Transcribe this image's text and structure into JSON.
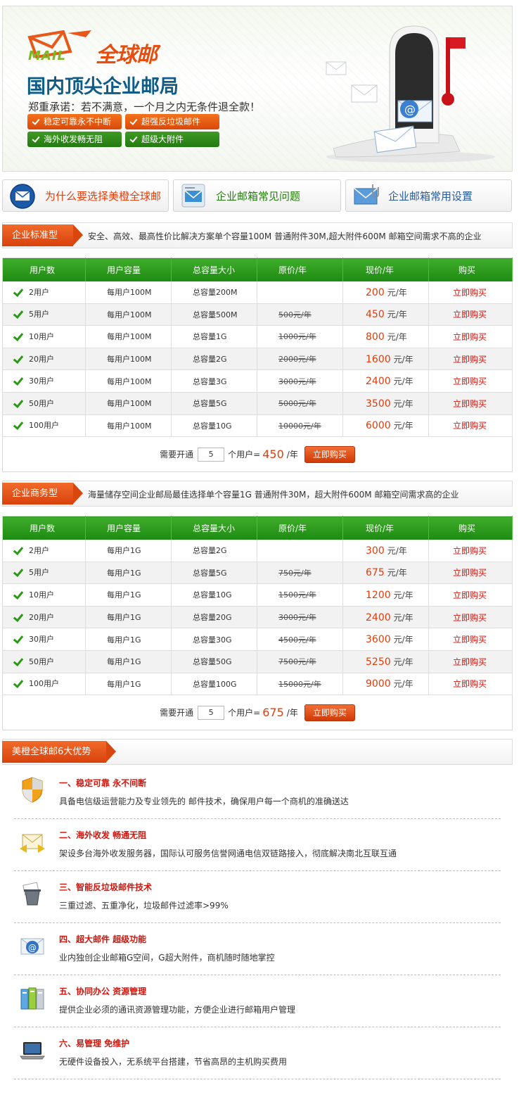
{
  "banner": {
    "logo_mail": "MAIL",
    "logo_text": "全球邮",
    "headline": "国内顶尖企业邮局",
    "promise": "郑重承诺：若不满意，一个月之内无条件退全款！",
    "tags": [
      "稳定可靠永不中断",
      "超强反垃圾邮件",
      "海外收发畅无阻",
      "超级大附件"
    ]
  },
  "quick_links": [
    {
      "label": "为什么要选择美橙全球邮",
      "icon": "email-globe-icon",
      "color": "#e2410f"
    },
    {
      "label": "企业邮箱常见问题",
      "icon": "envelope-card-icon",
      "color": "#277d12"
    },
    {
      "label": "企业邮箱常用设置",
      "icon": "envelope-clip-icon",
      "color": "#2a5c9c"
    }
  ],
  "standard": {
    "tag": "企业标准型",
    "desc": "安全、高效、最高性价比解决方案单个容量100M 普通附件30M,超大附件600M 邮箱空间需求不高的企业",
    "headers": [
      "用户数",
      "用户容量",
      "总容量大小",
      "原价/年",
      "现价/年",
      "购买"
    ],
    "rows": [
      {
        "users": "2用户",
        "per": "每用户100M",
        "total": "总容量200M",
        "orig": "",
        "price": "200",
        "unit": "元/年",
        "buy": "立即购买"
      },
      {
        "users": "5用户",
        "per": "每用户100M",
        "total": "总容量500M",
        "orig": "500元/年",
        "price": "450",
        "unit": "元/年",
        "buy": "立即购买"
      },
      {
        "users": "10用户",
        "per": "每用户100M",
        "total": "总容量1G",
        "orig": "1000元/年",
        "price": "800",
        "unit": "元/年",
        "buy": "立即购买"
      },
      {
        "users": "20用户",
        "per": "每用户100M",
        "total": "总容量2G",
        "orig": "2000元/年",
        "price": "1600",
        "unit": "元/年",
        "buy": "立即购买"
      },
      {
        "users": "30用户",
        "per": "每用户100M",
        "total": "总容量3G",
        "orig": "3000元/年",
        "price": "2400",
        "unit": "元/年",
        "buy": "立即购买"
      },
      {
        "users": "50用户",
        "per": "每用户100M",
        "total": "总容量5G",
        "orig": "5000元/年",
        "price": "3500",
        "unit": "元/年",
        "buy": "立即购买"
      },
      {
        "users": "100用户",
        "per": "每用户100M",
        "total": "总容量10G",
        "orig": "10000元/年",
        "price": "6000",
        "unit": "元/年",
        "buy": "立即购买"
      }
    ],
    "order": {
      "need": "需要开通",
      "qty": "5",
      "per": "个用户=",
      "total": "450",
      "yr": "/年",
      "button": "立即购买"
    }
  },
  "business": {
    "tag": "企业商务型",
    "desc": "海量储存空间企业邮局最佳选择单个容量1G 普通附件30M，超大附件600M 邮箱空间需求高的企业",
    "headers": [
      "用户数",
      "用户容量",
      "总容量大小",
      "原价/年",
      "现价/年",
      "购买"
    ],
    "rows": [
      {
        "users": "2用户",
        "per": "每用户1G",
        "total": "总容量2G",
        "orig": "",
        "price": "300",
        "unit": "元/年",
        "buy": "立即购买"
      },
      {
        "users": "5用户",
        "per": "每用户1G",
        "total": "总容量5G",
        "orig": "750元/年",
        "price": "675",
        "unit": "元/年",
        "buy": "立即购买"
      },
      {
        "users": "10用户",
        "per": "每用户1G",
        "total": "总容量10G",
        "orig": "1500元/年",
        "price": "1200",
        "unit": "元/年",
        "buy": "立即购买"
      },
      {
        "users": "20用户",
        "per": "每用户1G",
        "total": "总容量20G",
        "orig": "3000元/年",
        "price": "2400",
        "unit": "元/年",
        "buy": "立即购买"
      },
      {
        "users": "30用户",
        "per": "每用户1G",
        "total": "总容量30G",
        "orig": "4500元/年",
        "price": "3600",
        "unit": "元/年",
        "buy": "立即购买"
      },
      {
        "users": "50用户",
        "per": "每用户1G",
        "total": "总容量50G",
        "orig": "7500元/年",
        "price": "5250",
        "unit": "元/年",
        "buy": "立即购买"
      },
      {
        "users": "100用户",
        "per": "每用户1G",
        "total": "总容量100G",
        "orig": "15000元/年",
        "price": "9000",
        "unit": "元/年",
        "buy": "立即购买"
      }
    ],
    "order": {
      "need": "需要开通",
      "qty": "5",
      "per": "个用户=",
      "total": "675",
      "yr": "/年",
      "button": "立即购买"
    }
  },
  "advantages": {
    "tag": "美橙全球邮6大优势",
    "items": [
      {
        "title": "一、稳定可靠  永不间断",
        "desc": "具备电信级运营能力及专业领先的 邮件技术，确保用户每一个商机的准确送达",
        "icon": "shield-icon"
      },
      {
        "title": "二、海外收发  畅通无阻",
        "desc": "架设多台海外收发服务器，国际认可服务信誉网通电信双链路接入，彻底解决南北互联互通",
        "icon": "envelope-arrows-icon"
      },
      {
        "title": "三、智能反垃圾邮件技术",
        "desc": "三重过滤、五重净化，垃圾邮件过滤率>99%",
        "icon": "trash-filter-icon"
      },
      {
        "title": "四、超大邮件  超级功能",
        "desc": "业内独创企业邮箱G空间，G超大附件，商机随时随地掌控",
        "icon": "at-envelope-icon"
      },
      {
        "title": "五、协同办公  资源管理",
        "desc": "提供企业必须的通讯资源管理功能，方便企业进行邮箱用户管理",
        "icon": "servers-icon"
      },
      {
        "title": "六、易管理  免维护",
        "desc": "无硬件设备投入，无系统平台搭建，节省高昂的主机购买费用",
        "icon": "laptop-icon"
      }
    ]
  }
}
